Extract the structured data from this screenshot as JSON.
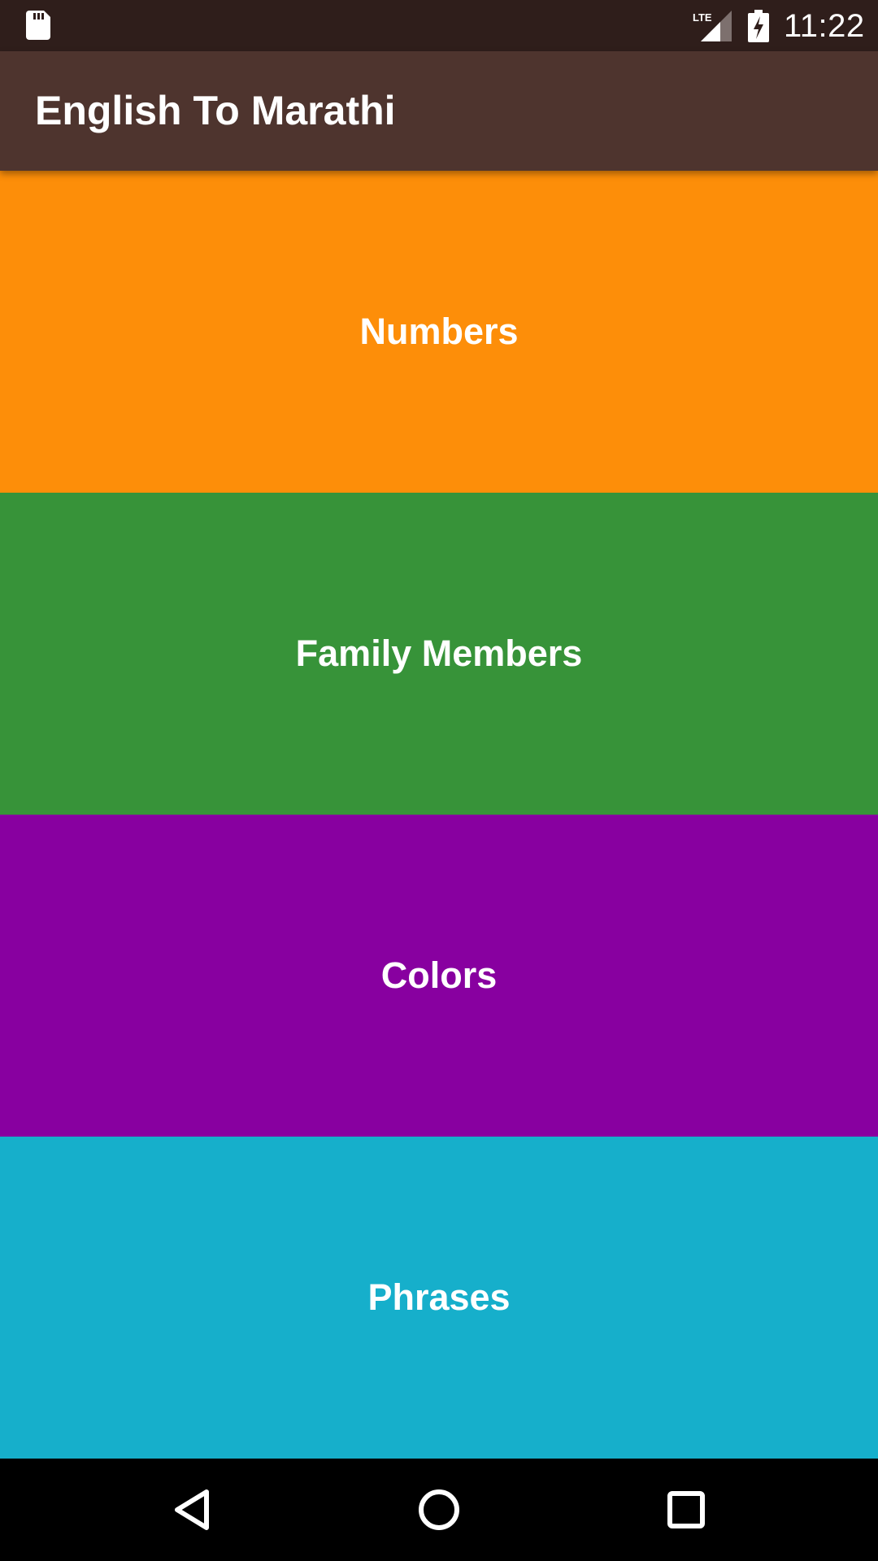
{
  "status_bar": {
    "time": "11:22",
    "network_label": "LTE",
    "icons": [
      "sd-card-icon",
      "lte-signal-icon",
      "battery-charging-icon"
    ]
  },
  "app_bar": {
    "title": "English To Marathi",
    "background": "#4e342e"
  },
  "categories": [
    {
      "label": "Numbers",
      "color": "#fd8e09"
    },
    {
      "label": "Family Members",
      "color": "#379339"
    },
    {
      "label": "Colors",
      "color": "#8800a0"
    },
    {
      "label": "Phrases",
      "color": "#16afcb"
    }
  ],
  "nav_bar": {
    "icons": [
      "back-icon",
      "home-icon",
      "recents-icon"
    ]
  }
}
